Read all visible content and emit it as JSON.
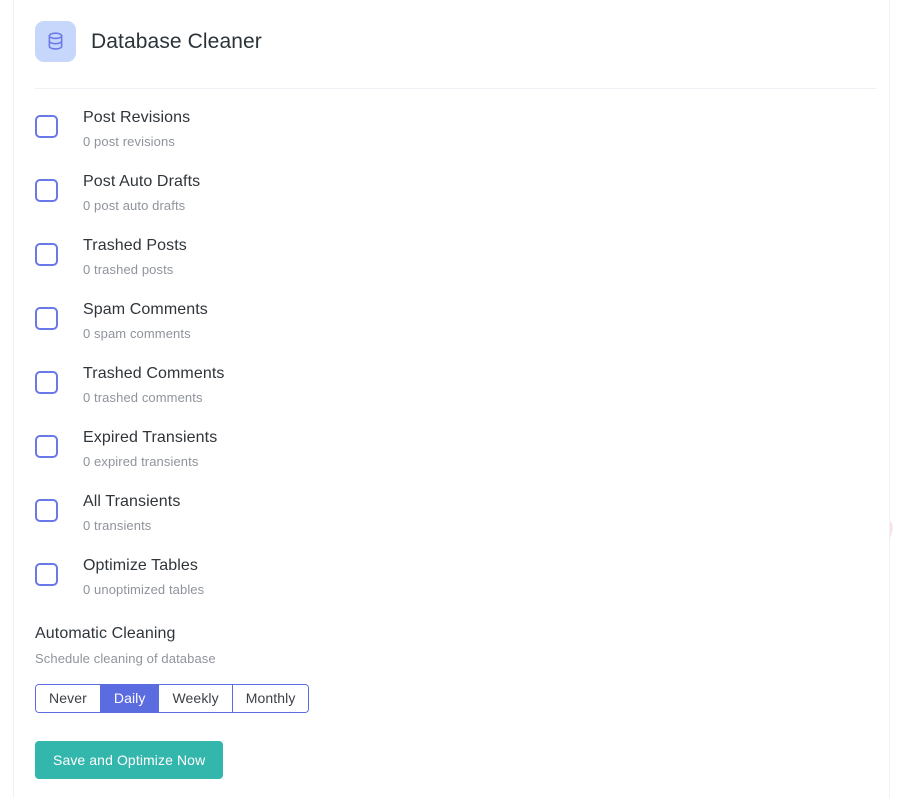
{
  "header": {
    "icon": "database-icon",
    "title": "Database Cleaner",
    "icon_bg": "#c7d7fb",
    "icon_color": "#6b78e8"
  },
  "items": [
    {
      "label": "Post Revisions",
      "count_text": "0 post revisions",
      "checked": false
    },
    {
      "label": "Post Auto Drafts",
      "count_text": "0 post auto drafts",
      "checked": false
    },
    {
      "label": "Trashed Posts",
      "count_text": "0 trashed posts",
      "checked": false
    },
    {
      "label": "Spam Comments",
      "count_text": "0 spam comments",
      "checked": false
    },
    {
      "label": "Trashed Comments",
      "count_text": "0 trashed comments",
      "checked": false
    },
    {
      "label": "Expired Transients",
      "count_text": "0 expired transients",
      "checked": false
    },
    {
      "label": "All Transients",
      "count_text": "0 transients",
      "checked": false
    },
    {
      "label": "Optimize Tables",
      "count_text": "0 unoptimized tables",
      "checked": false
    }
  ],
  "automatic_cleaning": {
    "title": "Automatic Cleaning",
    "subtitle": "Schedule cleaning of database",
    "options": [
      "Never",
      "Daily",
      "Weekly",
      "Monthly"
    ],
    "selected": "Daily",
    "accent_color": "#5b6ce0"
  },
  "actions": {
    "save_label": "Save and Optimize Now",
    "save_color": "#33b6ac"
  },
  "watermark": {
    "url": "https://www.pythonthree.com",
    "chinese": "晓得博客",
    "color": "#fbe4e7"
  }
}
